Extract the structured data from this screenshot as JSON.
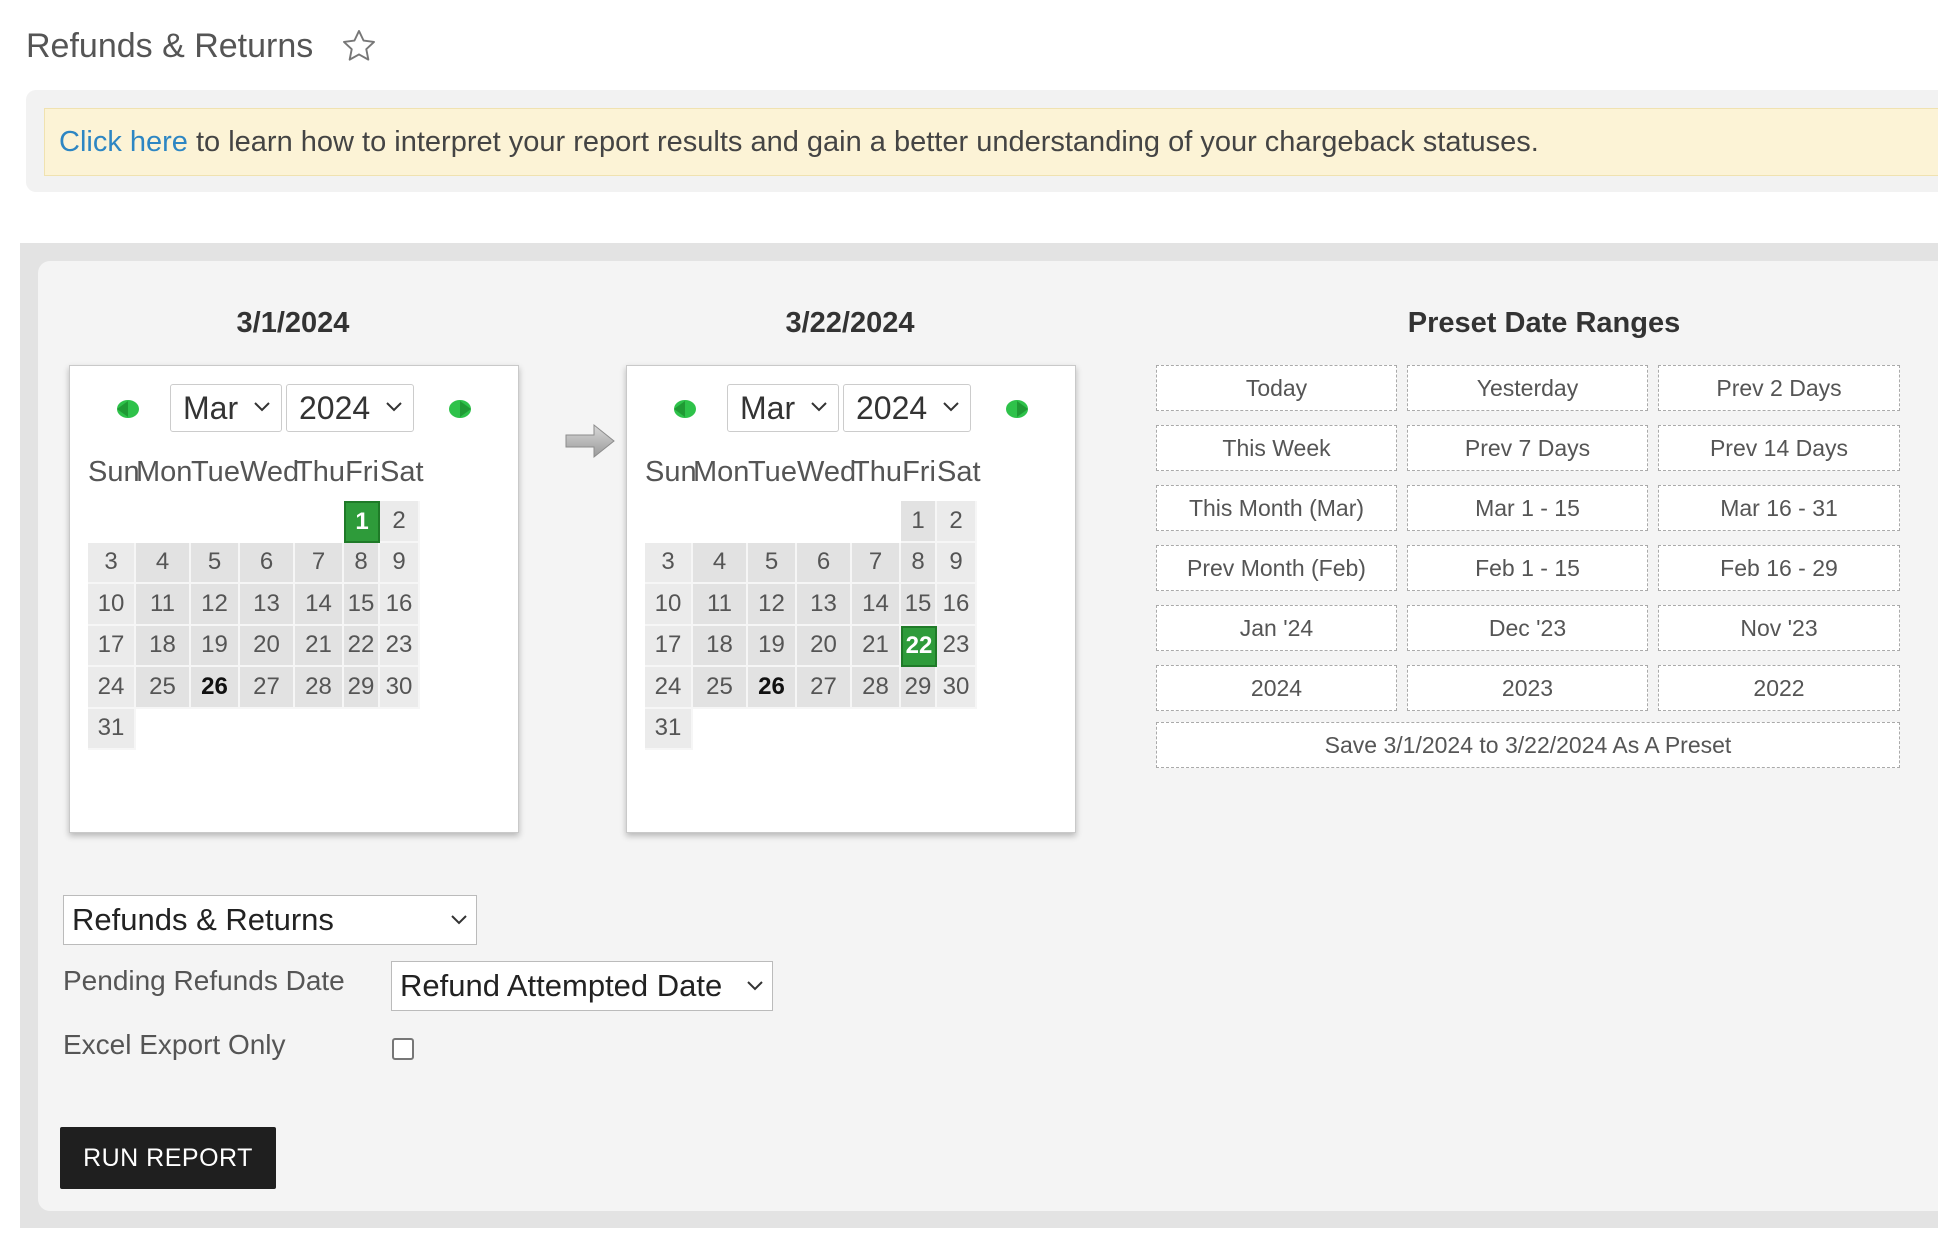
{
  "page": {
    "title": "Refunds & Returns",
    "favorite_icon": "star-outline-icon"
  },
  "notice": {
    "link_text": "Click here",
    "text": " to learn how to interpret your report results and gain a better understanding of your chargeback statuses."
  },
  "start_calendar": {
    "heading": "3/1/2024",
    "month": "Mar",
    "year": "2024",
    "selected_day": "1",
    "today": "26"
  },
  "end_calendar": {
    "heading": "3/22/2024",
    "month": "Mar",
    "year": "2024",
    "selected_day": "22",
    "today": "26"
  },
  "weekdays": [
    "Sun",
    "Mon",
    "Tue",
    "Wed",
    "Thu",
    "Fri",
    "Sat"
  ],
  "presets": {
    "title": "Preset Date Ranges",
    "items": [
      "Today",
      "Yesterday",
      "Prev 2 Days",
      "This Week",
      "Prev 7 Days",
      "Prev 14 Days",
      "This Month (Mar)",
      "Mar 1 - 15",
      "Mar 16 - 31",
      "Prev Month (Feb)",
      "Feb 1 - 15",
      "Feb 16 - 29",
      "Jan '24",
      "Dec '23",
      "Nov '23",
      "2024",
      "2023",
      "2022"
    ],
    "save_label": "Save 3/1/2024 to 3/22/2024 As A Preset"
  },
  "form": {
    "report_type": "Refunds & Returns",
    "pending_label": "Pending Refunds Date",
    "pending_value": "Refund Attempted Date",
    "excel_label": "Excel Export Only",
    "excel_checked": false,
    "run_label": "RUN REPORT"
  },
  "colors": {
    "selected_day": "#2e9b3a",
    "link": "#2d86c3",
    "notice_bg": "#fcf3d6",
    "button_bg": "#1f1f1f"
  }
}
